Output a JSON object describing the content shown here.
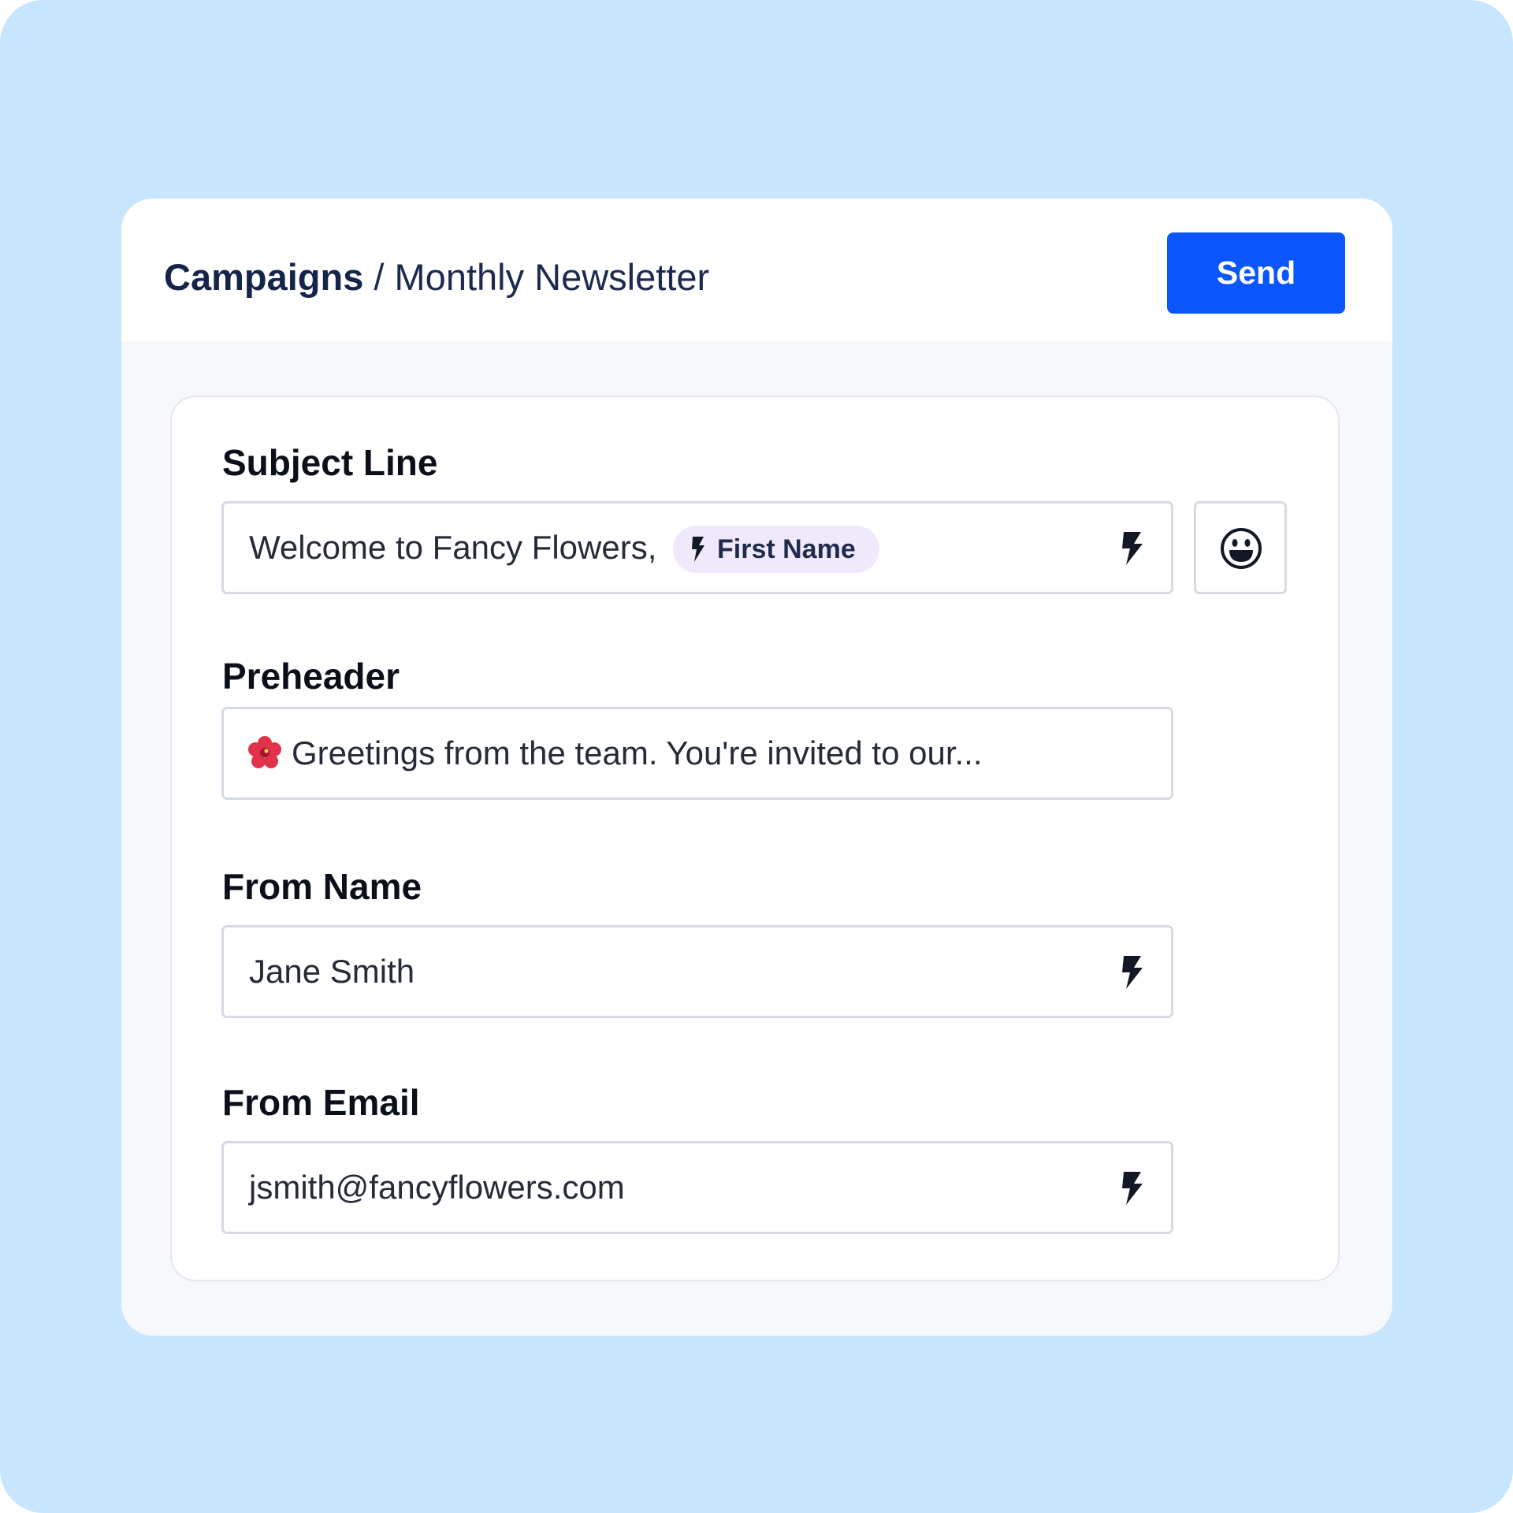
{
  "breadcrumb": {
    "root": "Campaigns",
    "separator": " / ",
    "current": "Monthly Newsletter"
  },
  "actions": {
    "send_label": "Send"
  },
  "form": {
    "subject": {
      "label": "Subject Line",
      "value": "Welcome to Fancy Flowers,",
      "token": "First Name"
    },
    "preheader": {
      "label": "Preheader",
      "value": "Greetings from the team. You're invited to our..."
    },
    "from_name": {
      "label": "From Name",
      "value": "Jane Smith"
    },
    "from_email": {
      "label": "From Email",
      "value": "jsmith@fancyflowers.com"
    }
  },
  "icons": {
    "personalize": "bolt-icon",
    "emoji_picker": "smiley-icon",
    "preheader_emoji": "hibiscus-icon"
  },
  "colors": {
    "background": "#c7e5fc",
    "accent": "#0a56fb",
    "token_chip": "#efe9fb",
    "text_dark": "#14244a"
  }
}
